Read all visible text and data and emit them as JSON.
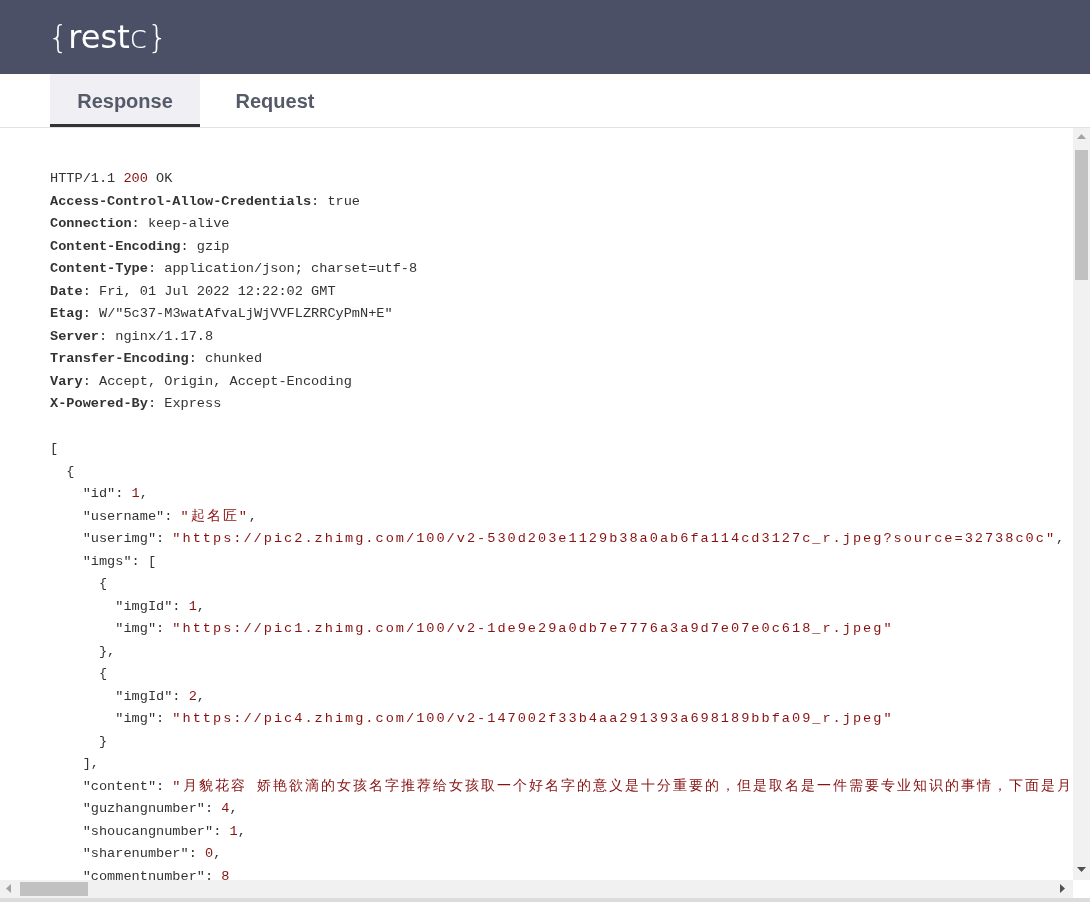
{
  "logo": "{**rest**c}",
  "tabs": [
    {
      "label": "Response",
      "selected": true
    },
    {
      "label": "Request",
      "selected": false
    }
  ],
  "status_line": {
    "protocol": "HTTP/1.1",
    "code": "200",
    "text": "OK"
  },
  "headers": [
    {
      "name": "Access-Control-Allow-Credentials",
      "sep": ":",
      "value": "true"
    },
    {
      "name": "Connection",
      "sep": ":",
      "value": "keep-alive"
    },
    {
      "name": "Content-Encoding",
      "sep": ":",
      "value": "gzip"
    },
    {
      "name": "Content-Type",
      "sep": ":",
      "value": "application/json; charset=utf-8"
    },
    {
      "name": "Date",
      "sep": ":",
      "value": "Fri, 01 Jul 2022 12:22:02 GMT"
    },
    {
      "name": "Etag",
      "sep": ":",
      "value": "W/\"5c37-M3watAfvaLjWjVVFLZRRCyPmN+E\""
    },
    {
      "name": "Server",
      "sep": ":",
      "value": "nginx/1.17.8"
    },
    {
      "name": "Transfer-Encoding",
      "sep": ":",
      "value": "chunked"
    },
    {
      "name": "Vary",
      "sep": ":",
      "value": "Accept, Origin, Accept-Encoding"
    },
    {
      "name": "X-Powered-By",
      "sep": ":",
      "value": "Express"
    }
  ],
  "body": {
    "kind": "block",
    "open": "[",
    "children": [
      {
        "kind": "block",
        "open": "{",
        "children": [
          {
            "kind": "number",
            "key": "\"id\":",
            "value": "1",
            "suffix": ","
          },
          {
            "kind": "string",
            "key": "\"username\":",
            "value": "\"起名匠\"",
            "suffix": ","
          },
          {
            "kind": "string",
            "key": "\"userimg\":",
            "value": "\"https://pic2.zhimg.com/100/v2-530d203e1129b38a0ab6fa114cd3127c_r.jpeg?source=32738c0c\"",
            "suffix": ","
          },
          {
            "kind": "block",
            "key": "\"imgs\":",
            "open": "[",
            "close": "],",
            "children": [
              {
                "kind": "block",
                "open": "{",
                "close": "},",
                "children": [
                  {
                    "kind": "number",
                    "key": "\"imgId\":",
                    "value": "1",
                    "suffix": ","
                  },
                  {
                    "kind": "string",
                    "key": "\"img\":",
                    "value": "\"https://pic1.zhimg.com/100/v2-1de9e29a0db7e7776a3a9d7e07e0c618_r.jpeg\""
                  }
                ]
              },
              {
                "kind": "block",
                "open": "{",
                "close": "}",
                "children": [
                  {
                    "kind": "number",
                    "key": "\"imgId\":",
                    "value": "2",
                    "suffix": ","
                  },
                  {
                    "kind": "string",
                    "key": "\"img\":",
                    "value": "\"https://pic4.zhimg.com/100/v2-147002f33b4aa291393a698189bbfa09_r.jpeg\""
                  }
                ]
              }
            ]
          },
          {
            "kind": "string",
            "key": "\"content\":",
            "value": "\"月貌花容 娇艳欲滴的女孩名字推荐给女孩取一个好名字的意义是十分重要的，但是取名是一件需要专业知识的事情，下面是月"
          },
          {
            "kind": "number",
            "key": "\"guzhangnumber\":",
            "value": "4",
            "suffix": ","
          },
          {
            "kind": "number",
            "key": "\"shoucangnumber\":",
            "value": "1",
            "suffix": ","
          },
          {
            "kind": "number",
            "key": "\"sharenumber\":",
            "value": "0",
            "suffix": ","
          },
          {
            "kind": "number",
            "key": "\"commentnumber\":",
            "value": "8"
          }
        ]
      }
    ]
  }
}
